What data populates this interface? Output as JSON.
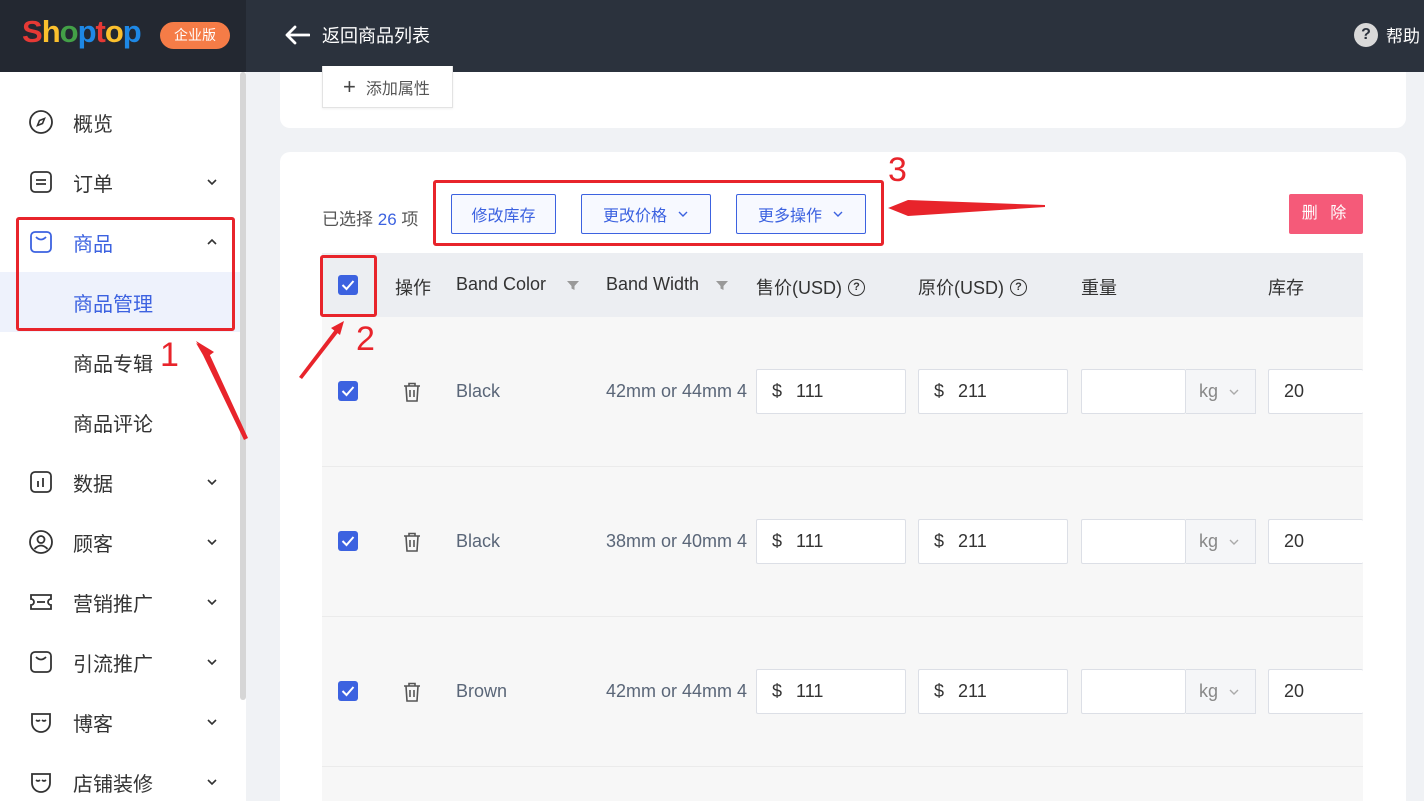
{
  "header": {
    "logo_text": "Shoptop",
    "edition_badge": "企业版",
    "back_label": "返回商品列表",
    "help_label": "帮助"
  },
  "sidebar": {
    "items": [
      {
        "label": "概览",
        "icon": "compass-icon"
      },
      {
        "label": "订单",
        "icon": "order-icon"
      },
      {
        "label": "商品",
        "icon": "bag-icon"
      },
      {
        "label": "数据",
        "icon": "chart-icon"
      },
      {
        "label": "顾客",
        "icon": "user-icon"
      },
      {
        "label": "营销推广",
        "icon": "ticket-icon"
      },
      {
        "label": "引流推广",
        "icon": "bag-icon"
      },
      {
        "label": "博客",
        "icon": "blog-icon"
      },
      {
        "label": "店铺装修",
        "icon": "store-icon"
      }
    ],
    "sub_items": [
      "商品管理",
      "商品专辑",
      "商品评论"
    ]
  },
  "attributes": {
    "add_label": "添加属性"
  },
  "bulk": {
    "selected_prefix": "已选择",
    "selected_count": "26",
    "selected_suffix": "项",
    "edit_stock": "修改库存",
    "change_price": "更改价格",
    "more_actions": "更多操作",
    "delete": "删 除"
  },
  "table": {
    "columns": [
      "操作",
      "Band Color",
      "Band Width",
      "售价(USD)",
      "原价(USD)",
      "重量",
      "库存"
    ],
    "currency_symbol": "$",
    "rows": [
      {
        "color": "Black",
        "width": "42mm or 44mm 4",
        "price": "111",
        "original": "211",
        "weight": "",
        "unit": "kg",
        "stock": "20"
      },
      {
        "color": "Black",
        "width": "38mm or 40mm 4",
        "price": "111",
        "original": "211",
        "weight": "",
        "unit": "kg",
        "stock": "20"
      },
      {
        "color": "Brown",
        "width": "42mm or 44mm 4",
        "price": "111",
        "original": "211",
        "weight": "",
        "unit": "kg",
        "stock": "20"
      }
    ]
  },
  "annotations": {
    "labels": [
      "1",
      "2",
      "3"
    ],
    "color": "#e8242b"
  },
  "colors": {
    "accent": "#3c62e0",
    "topbar": "#2b323d",
    "delete": "#f55a79"
  }
}
